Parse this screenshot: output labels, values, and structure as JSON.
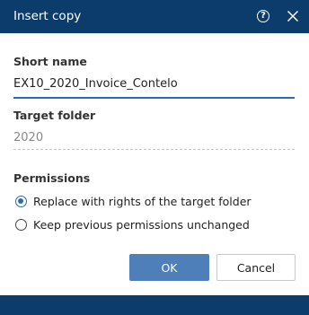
{
  "dialog": {
    "title": "Insert copy",
    "help_label": "?",
    "close_label": "close"
  },
  "short_name": {
    "label": "Short name",
    "value": "EX10_2020_Invoice_Contelo"
  },
  "target_folder": {
    "label": "Target folder",
    "value": "2020"
  },
  "permissions": {
    "label": "Permissions",
    "options": [
      {
        "label": "Replace with rights of the target folder",
        "checked": true
      },
      {
        "label": "Keep previous permissions unchanged",
        "checked": false
      }
    ]
  },
  "buttons": {
    "ok": "OK",
    "cancel": "Cancel"
  },
  "colors": {
    "titlebar": "#0b3c6b",
    "accent": "#2b6cb0",
    "ok_button": "#4e7fb8"
  }
}
